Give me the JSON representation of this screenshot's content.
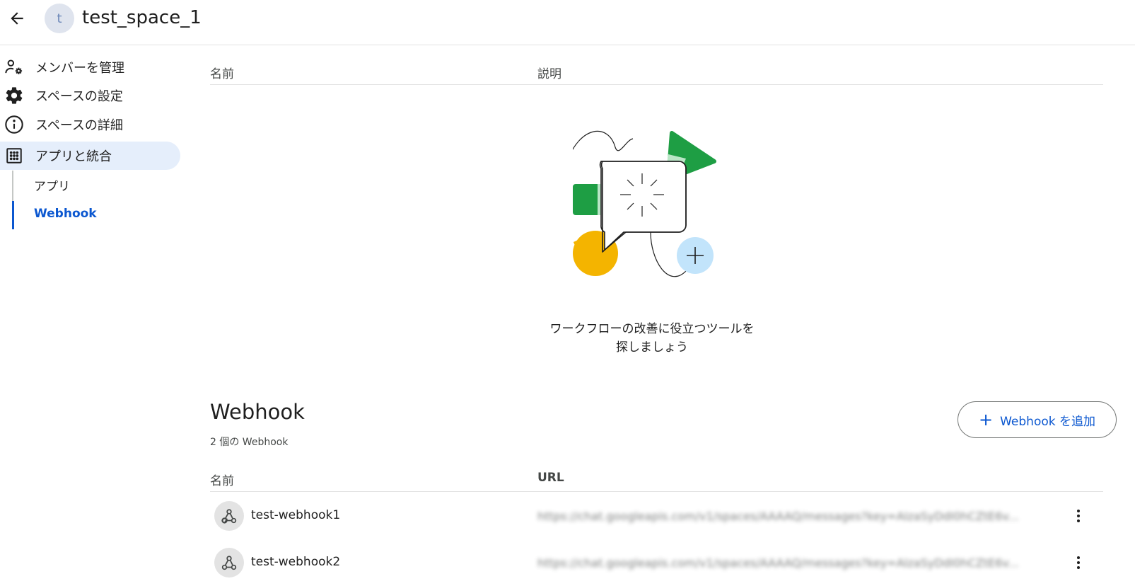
{
  "header": {
    "back_icon": "arrow-back-icon",
    "avatar_letter": "t",
    "title": "test_space_1"
  },
  "sidebar": {
    "items": [
      {
        "label": "メンバーを管理",
        "icon": "manage-members-icon"
      },
      {
        "label": "スペースの設定",
        "icon": "gear-icon"
      },
      {
        "label": "スペースの詳細",
        "icon": "info-icon"
      },
      {
        "label": "アプリと統合",
        "icon": "apps-grid-icon"
      }
    ],
    "subitems": [
      {
        "label": "アプリ"
      },
      {
        "label": "Webhook"
      }
    ]
  },
  "apps": {
    "columns": {
      "name": "名前",
      "description": "説明"
    },
    "empty_line1": "ワークフローの改善に役立つツールを",
    "empty_line2": "探しましょう"
  },
  "webhooks": {
    "title": "Webhook",
    "count": "2 個の Webhook",
    "add_button": "Webhook を追加",
    "columns": {
      "name": "名前",
      "url": "URL"
    },
    "rows": [
      {
        "name": "test-webhook1",
        "url": "https://chat.googleapis.com/v1/spaces/AAAAQ/messages?key=AIzaSyDdI0hCZtE6v..."
      },
      {
        "name": "test-webhook2",
        "url": "https://chat.googleapis.com/v1/spaces/AAAAQ/messages?key=AIzaSyDdI0hCZtE6v..."
      }
    ]
  },
  "colors": {
    "accent": "#0b57d0",
    "active_bg": "#e5eefb",
    "green": "#1e9e44",
    "yellow": "#f4b400",
    "light_blue": "#c2e4fb"
  }
}
